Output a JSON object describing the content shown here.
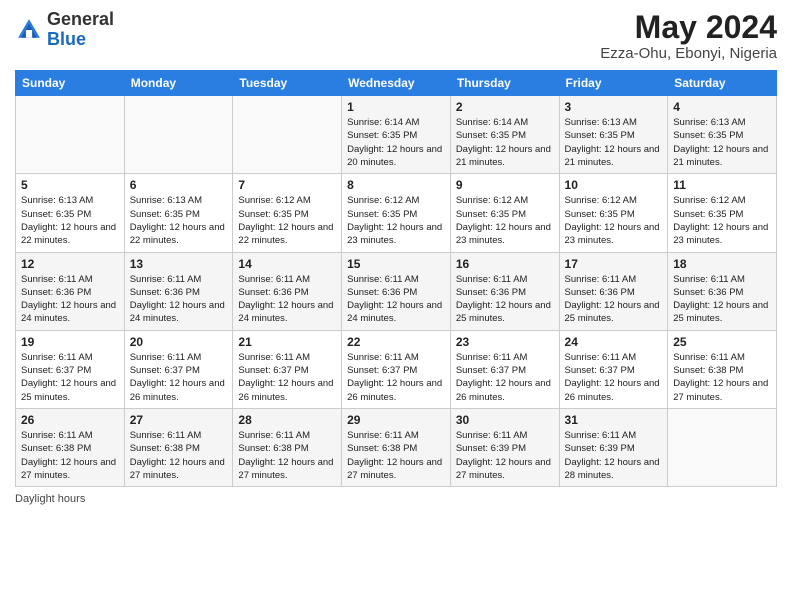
{
  "logo": {
    "general": "General",
    "blue": "Blue"
  },
  "header": {
    "monthYear": "May 2024",
    "location": "Ezza-Ohu, Ebonyi, Nigeria"
  },
  "weekdays": [
    "Sunday",
    "Monday",
    "Tuesday",
    "Wednesday",
    "Thursday",
    "Friday",
    "Saturday"
  ],
  "footer": {
    "daylightLabel": "Daylight hours"
  },
  "weeks": [
    [
      {
        "day": "",
        "sunrise": "",
        "sunset": "",
        "daylight": ""
      },
      {
        "day": "",
        "sunrise": "",
        "sunset": "",
        "daylight": ""
      },
      {
        "day": "",
        "sunrise": "",
        "sunset": "",
        "daylight": ""
      },
      {
        "day": "1",
        "sunrise": "Sunrise: 6:14 AM",
        "sunset": "Sunset: 6:35 PM",
        "daylight": "Daylight: 12 hours and 20 minutes."
      },
      {
        "day": "2",
        "sunrise": "Sunrise: 6:14 AM",
        "sunset": "Sunset: 6:35 PM",
        "daylight": "Daylight: 12 hours and 21 minutes."
      },
      {
        "day": "3",
        "sunrise": "Sunrise: 6:13 AM",
        "sunset": "Sunset: 6:35 PM",
        "daylight": "Daylight: 12 hours and 21 minutes."
      },
      {
        "day": "4",
        "sunrise": "Sunrise: 6:13 AM",
        "sunset": "Sunset: 6:35 PM",
        "daylight": "Daylight: 12 hours and 21 minutes."
      }
    ],
    [
      {
        "day": "5",
        "sunrise": "Sunrise: 6:13 AM",
        "sunset": "Sunset: 6:35 PM",
        "daylight": "Daylight: 12 hours and 22 minutes."
      },
      {
        "day": "6",
        "sunrise": "Sunrise: 6:13 AM",
        "sunset": "Sunset: 6:35 PM",
        "daylight": "Daylight: 12 hours and 22 minutes."
      },
      {
        "day": "7",
        "sunrise": "Sunrise: 6:12 AM",
        "sunset": "Sunset: 6:35 PM",
        "daylight": "Daylight: 12 hours and 22 minutes."
      },
      {
        "day": "8",
        "sunrise": "Sunrise: 6:12 AM",
        "sunset": "Sunset: 6:35 PM",
        "daylight": "Daylight: 12 hours and 23 minutes."
      },
      {
        "day": "9",
        "sunrise": "Sunrise: 6:12 AM",
        "sunset": "Sunset: 6:35 PM",
        "daylight": "Daylight: 12 hours and 23 minutes."
      },
      {
        "day": "10",
        "sunrise": "Sunrise: 6:12 AM",
        "sunset": "Sunset: 6:35 PM",
        "daylight": "Daylight: 12 hours and 23 minutes."
      },
      {
        "day": "11",
        "sunrise": "Sunrise: 6:12 AM",
        "sunset": "Sunset: 6:35 PM",
        "daylight": "Daylight: 12 hours and 23 minutes."
      }
    ],
    [
      {
        "day": "12",
        "sunrise": "Sunrise: 6:11 AM",
        "sunset": "Sunset: 6:36 PM",
        "daylight": "Daylight: 12 hours and 24 minutes."
      },
      {
        "day": "13",
        "sunrise": "Sunrise: 6:11 AM",
        "sunset": "Sunset: 6:36 PM",
        "daylight": "Daylight: 12 hours and 24 minutes."
      },
      {
        "day": "14",
        "sunrise": "Sunrise: 6:11 AM",
        "sunset": "Sunset: 6:36 PM",
        "daylight": "Daylight: 12 hours and 24 minutes."
      },
      {
        "day": "15",
        "sunrise": "Sunrise: 6:11 AM",
        "sunset": "Sunset: 6:36 PM",
        "daylight": "Daylight: 12 hours and 24 minutes."
      },
      {
        "day": "16",
        "sunrise": "Sunrise: 6:11 AM",
        "sunset": "Sunset: 6:36 PM",
        "daylight": "Daylight: 12 hours and 25 minutes."
      },
      {
        "day": "17",
        "sunrise": "Sunrise: 6:11 AM",
        "sunset": "Sunset: 6:36 PM",
        "daylight": "Daylight: 12 hours and 25 minutes."
      },
      {
        "day": "18",
        "sunrise": "Sunrise: 6:11 AM",
        "sunset": "Sunset: 6:36 PM",
        "daylight": "Daylight: 12 hours and 25 minutes."
      }
    ],
    [
      {
        "day": "19",
        "sunrise": "Sunrise: 6:11 AM",
        "sunset": "Sunset: 6:37 PM",
        "daylight": "Daylight: 12 hours and 25 minutes."
      },
      {
        "day": "20",
        "sunrise": "Sunrise: 6:11 AM",
        "sunset": "Sunset: 6:37 PM",
        "daylight": "Daylight: 12 hours and 26 minutes."
      },
      {
        "day": "21",
        "sunrise": "Sunrise: 6:11 AM",
        "sunset": "Sunset: 6:37 PM",
        "daylight": "Daylight: 12 hours and 26 minutes."
      },
      {
        "day": "22",
        "sunrise": "Sunrise: 6:11 AM",
        "sunset": "Sunset: 6:37 PM",
        "daylight": "Daylight: 12 hours and 26 minutes."
      },
      {
        "day": "23",
        "sunrise": "Sunrise: 6:11 AM",
        "sunset": "Sunset: 6:37 PM",
        "daylight": "Daylight: 12 hours and 26 minutes."
      },
      {
        "day": "24",
        "sunrise": "Sunrise: 6:11 AM",
        "sunset": "Sunset: 6:37 PM",
        "daylight": "Daylight: 12 hours and 26 minutes."
      },
      {
        "day": "25",
        "sunrise": "Sunrise: 6:11 AM",
        "sunset": "Sunset: 6:38 PM",
        "daylight": "Daylight: 12 hours and 27 minutes."
      }
    ],
    [
      {
        "day": "26",
        "sunrise": "Sunrise: 6:11 AM",
        "sunset": "Sunset: 6:38 PM",
        "daylight": "Daylight: 12 hours and 27 minutes."
      },
      {
        "day": "27",
        "sunrise": "Sunrise: 6:11 AM",
        "sunset": "Sunset: 6:38 PM",
        "daylight": "Daylight: 12 hours and 27 minutes."
      },
      {
        "day": "28",
        "sunrise": "Sunrise: 6:11 AM",
        "sunset": "Sunset: 6:38 PM",
        "daylight": "Daylight: 12 hours and 27 minutes."
      },
      {
        "day": "29",
        "sunrise": "Sunrise: 6:11 AM",
        "sunset": "Sunset: 6:38 PM",
        "daylight": "Daylight: 12 hours and 27 minutes."
      },
      {
        "day": "30",
        "sunrise": "Sunrise: 6:11 AM",
        "sunset": "Sunset: 6:39 PM",
        "daylight": "Daylight: 12 hours and 27 minutes."
      },
      {
        "day": "31",
        "sunrise": "Sunrise: 6:11 AM",
        "sunset": "Sunset: 6:39 PM",
        "daylight": "Daylight: 12 hours and 28 minutes."
      },
      {
        "day": "",
        "sunrise": "",
        "sunset": "",
        "daylight": ""
      }
    ]
  ]
}
